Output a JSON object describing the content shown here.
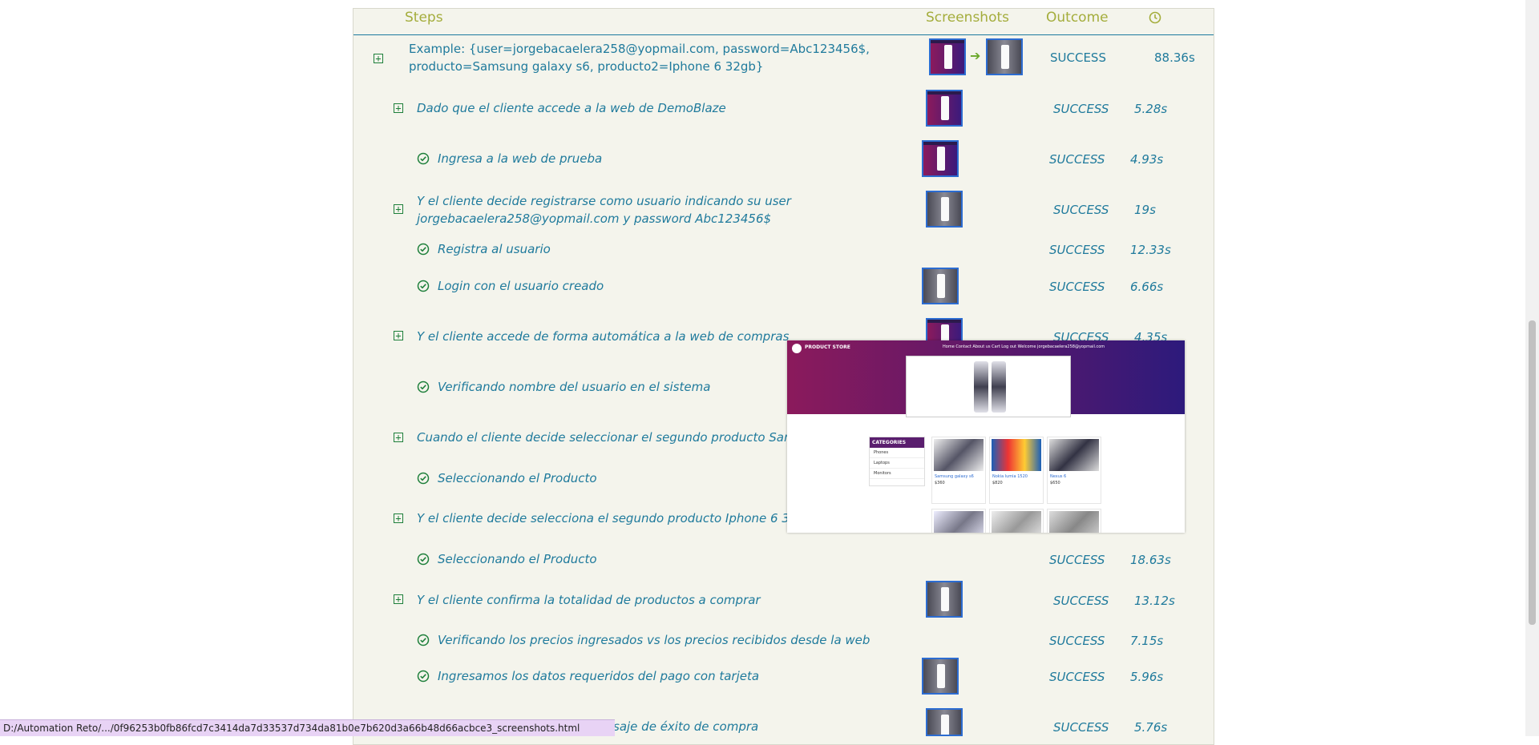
{
  "header": {
    "steps": "Steps",
    "screenshots": "Screenshots",
    "outcome": "Outcome"
  },
  "example": {
    "line1": "Example: {user=jorgebacaelera258@yopmail.com, password=Abc123456$,",
    "line2": "producto=Samsung galaxy s6, producto2=Iphone 6 32gb}",
    "outcome": "SUCCESS",
    "duration": "88.36s"
  },
  "steps": [
    {
      "text": "Dado que el cliente accede a la web de DemoBlaze",
      "outcome": "SUCCESS",
      "duration": "5.28s"
    },
    {
      "text": "Ingresa a la web de prueba",
      "outcome": "SUCCESS",
      "duration": "4.93s"
    },
    {
      "text": "Y el cliente decide registrarse como usuario indicando su user",
      "text2": "jorgebacaelera258@yopmail.com y password Abc123456$",
      "outcome": "SUCCESS",
      "duration": "19s"
    },
    {
      "text": "Registra al usuario",
      "outcome": "SUCCESS",
      "duration": "12.33s"
    },
    {
      "text": "Login con el usuario creado",
      "outcome": "SUCCESS",
      "duration": "6.66s"
    },
    {
      "text": "Y el cliente accede de forma automática a la web de compras",
      "outcome": "SUCCESS",
      "duration": "4.35s"
    },
    {
      "text": "Verificando nombre del usuario en el sistema"
    },
    {
      "text": "Cuando el cliente decide seleccionar el segundo producto Samsun"
    },
    {
      "text": "Seleccionando el Producto"
    },
    {
      "text": "Y el cliente decide selecciona el segundo producto Iphone 6 32gb"
    },
    {
      "text": "Seleccionando el Producto",
      "outcome": "SUCCESS",
      "duration": "18.63s"
    },
    {
      "text": "Y el cliente confirma la totalidad de productos a comprar",
      "outcome": "SUCCESS",
      "duration": "13.12s"
    },
    {
      "text": "Verificando los precios ingresados vs los precios recibidos desde la web",
      "outcome": "SUCCESS",
      "duration": "7.15s"
    },
    {
      "text": "Ingresamos los datos requeridos del pago con tarjeta",
      "outcome": "SUCCESS",
      "duration": "5.96s"
    },
    {
      "text": "saje de éxito de compra",
      "outcome": "SUCCESS",
      "duration": "5.76s"
    }
  ],
  "popup": {
    "brand": "PRODUCT STORE",
    "nav": "Home   Contact   About us   Cart   Log out   Welcome jorgebacaelera258@yopmail.com",
    "categories_title": "CATEGORIES",
    "categories": [
      "Phones",
      "Laptops",
      "Monitors"
    ],
    "cards": [
      {
        "title": "Samsung galaxy s6",
        "price": "$360"
      },
      {
        "title": "Nokia lumia 1520",
        "price": "$820"
      },
      {
        "title": "Nexus 6",
        "price": "$650"
      }
    ]
  },
  "status_bar": "D:/Automation Reto/.../0f96253b0fb86fcd7c3414da7d33537d734da81b0e7b620d3a66b48d66acbce3_screenshots.html"
}
